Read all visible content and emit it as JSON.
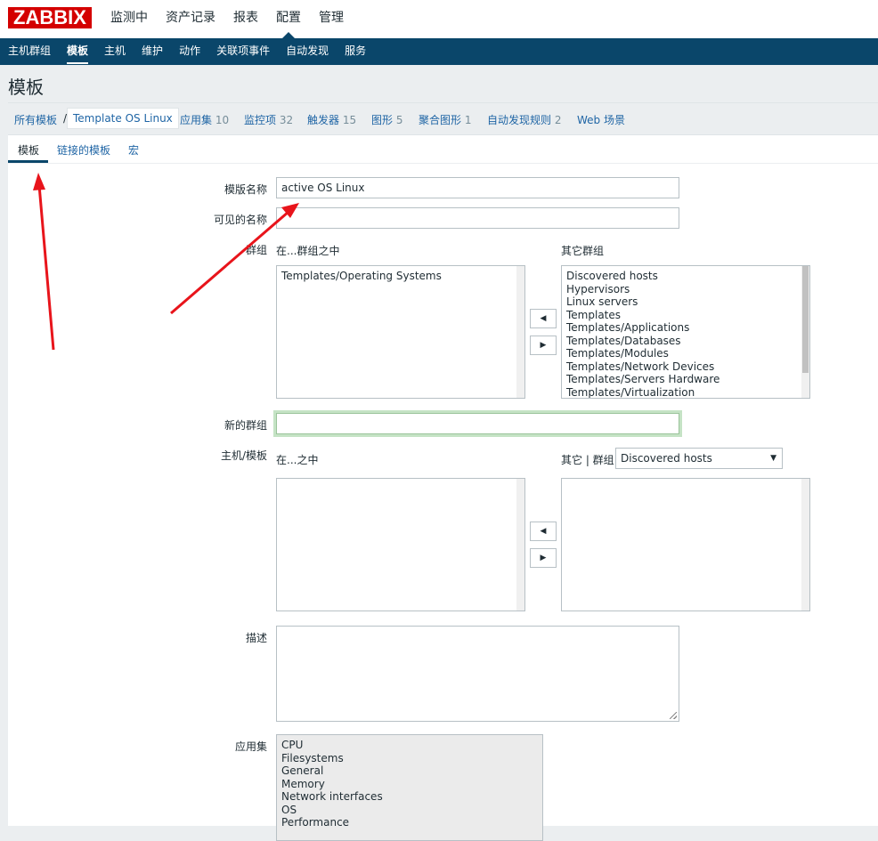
{
  "logo": "ZABBIX",
  "main_menu": [
    "监测中",
    "资产记录",
    "报表",
    "配置",
    "管理"
  ],
  "sub_menu": [
    "主机群组",
    "模板",
    "主机",
    "维护",
    "动作",
    "关联项事件",
    "自动发现",
    "服务"
  ],
  "page_title": "模板",
  "breadcrumb": {
    "all_templates": "所有模板",
    "separator": "/",
    "current": "Template OS Linux",
    "links": [
      {
        "label": "应用集",
        "count": "10"
      },
      {
        "label": "监控项",
        "count": "32"
      },
      {
        "label": "触发器",
        "count": "15"
      },
      {
        "label": "图形",
        "count": "5"
      },
      {
        "label": "聚合图形",
        "count": "1"
      },
      {
        "label": "自动发现规则",
        "count": "2"
      },
      {
        "label": "Web 场景",
        "count": ""
      }
    ]
  },
  "tabs": [
    "模板",
    "链接的模板",
    "宏"
  ],
  "form": {
    "template_name_label": "模版名称",
    "template_name_value": "active OS Linux",
    "visible_name_label": "可见的名称",
    "visible_name_value": "",
    "groups_label": "群组",
    "in_groups_label": "在...群组之中",
    "other_groups_label": "其它群组",
    "in_groups": [
      "Templates/Operating Systems"
    ],
    "other_groups": [
      "Discovered hosts",
      "Hypervisors",
      "Linux servers",
      "Templates",
      "Templates/Applications",
      "Templates/Databases",
      "Templates/Modules",
      "Templates/Network Devices",
      "Templates/Servers Hardware",
      "Templates/Virtualization"
    ],
    "new_group_label": "新的群组",
    "new_group_value": "",
    "hosts_label": "主机/模板",
    "in_label": "在...之中",
    "other_group_filter_label": "其它 | 群组",
    "other_group_filter_value": "Discovered hosts",
    "description_label": "描述",
    "applications_label": "应用集",
    "applications": [
      "CPU",
      "Filesystems",
      "General",
      "Memory",
      "Network interfaces",
      "OS",
      "Performance"
    ]
  },
  "colors": {
    "brand": "#d40000",
    "nav": "#0a466a",
    "link": "#1f65a5",
    "annotation": "#e8141b"
  }
}
